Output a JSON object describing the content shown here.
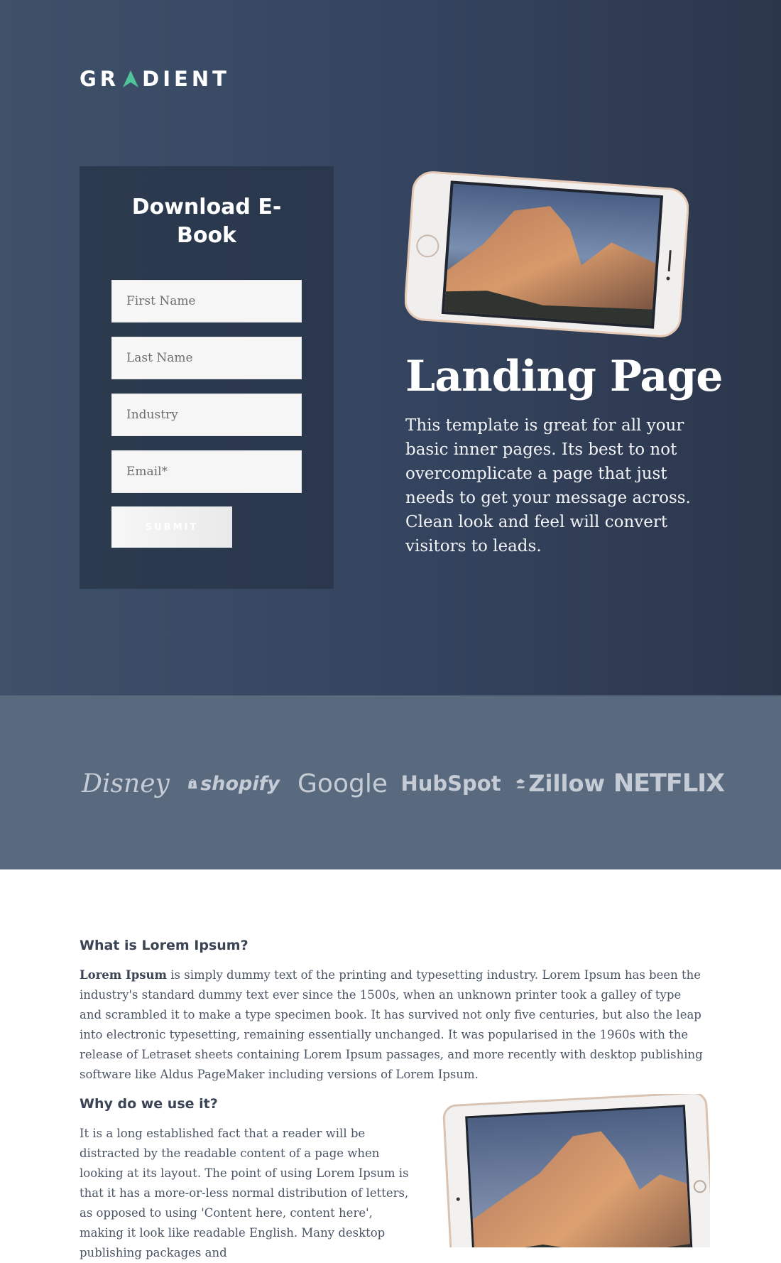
{
  "brand": {
    "logo_text_1": "GR",
    "logo_text_2": "DIENT",
    "accent": "#4fc39a"
  },
  "form": {
    "title": "Download E-Book",
    "first_name_placeholder": "First Name",
    "last_name_placeholder": "Last Name",
    "industry_placeholder": "Industry",
    "email_placeholder": "Email*",
    "submit_label": "SUBMIT"
  },
  "hero": {
    "title": "Landing Page",
    "description": "This template is great for all your basic inner pages. Its best to not overcomplicate a page that just needs to get your message across. Clean look and feel will convert visitors to leads."
  },
  "logos": {
    "disney": "Disney",
    "shopify": "shopify",
    "google": "Google",
    "hubspot": "HubSpot",
    "zillow": "Zillow",
    "netflix": "NETFLIX"
  },
  "content": {
    "section1_heading": "What is Lorem Ipsum?",
    "section1_bold": "Lorem Ipsum",
    "section1_text": " is simply dummy text of the printing and typesetting industry. Lorem Ipsum has been the industry's standard dummy text ever since the 1500s, when an unknown printer took a galley of type and scrambled it to make a type specimen book. It has survived not only five centuries, but also the leap into electronic typesetting, remaining essentially unchanged. It was popularised in the 1960s with the release of Letraset sheets containing Lorem Ipsum passages, and more recently with desktop publishing software like Aldus PageMaker including versions of Lorem Ipsum.",
    "section2_heading": "Why do we use it?",
    "section2_text": "It is a long established fact that a reader will be distracted by the readable content of a page when looking at its layout. The point of using Lorem Ipsum is that it has a more-or-less normal distribution of letters, as opposed to using 'Content here, content here', making it look like readable English. Many desktop publishing packages and"
  }
}
